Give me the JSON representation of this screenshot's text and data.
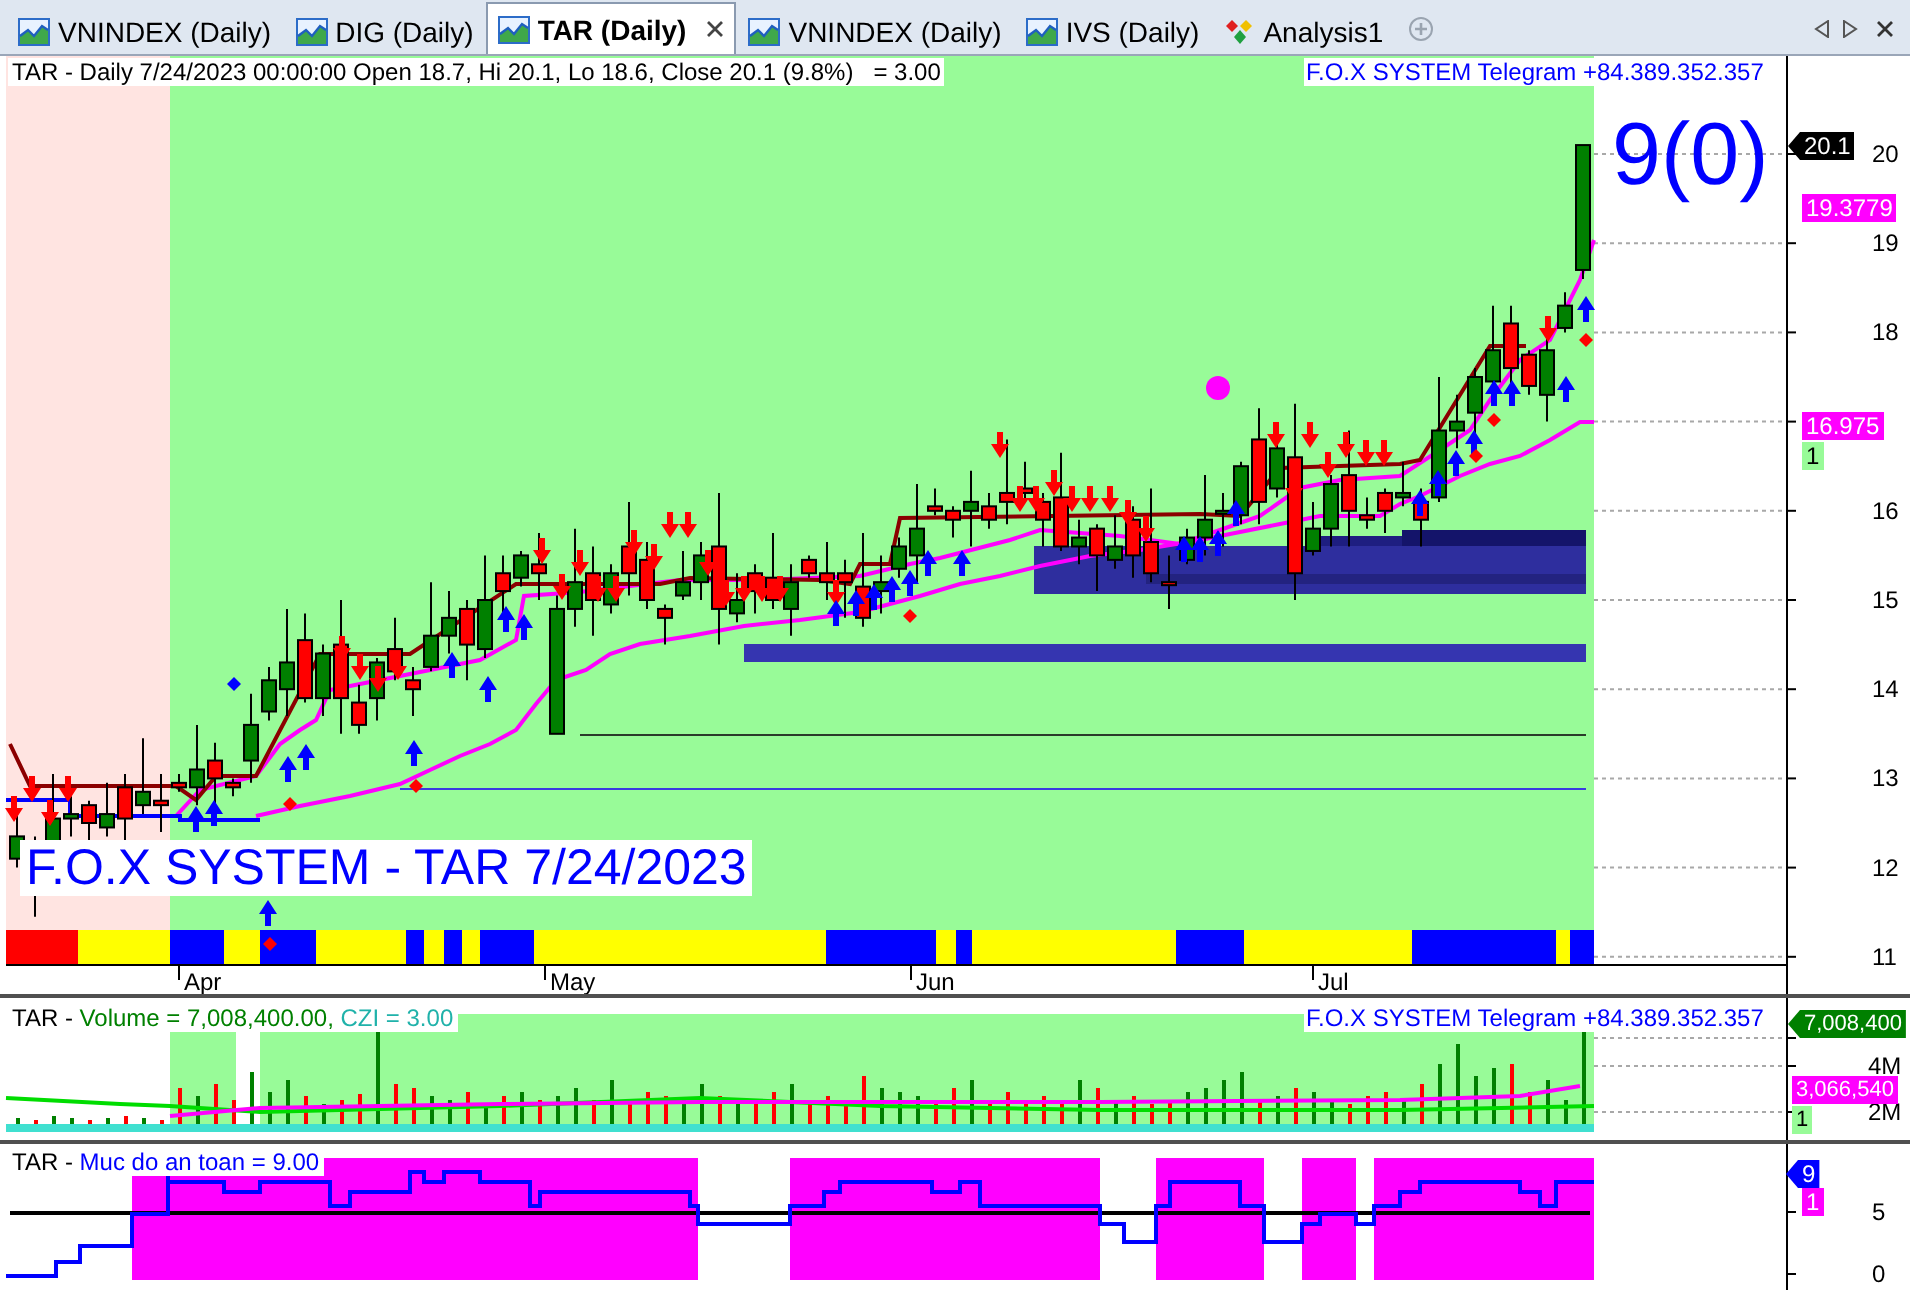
{
  "tabs": [
    {
      "label": "VNINDEX (Daily)",
      "selected": false,
      "kind": "chart"
    },
    {
      "label": "DIG (Daily)",
      "selected": false,
      "kind": "chart"
    },
    {
      "label": "TAR (Daily)",
      "selected": true,
      "kind": "chart"
    },
    {
      "label": "VNINDEX (Daily)",
      "selected": false,
      "kind": "chart"
    },
    {
      "label": "IVS (Daily)",
      "selected": false,
      "kind": "chart"
    },
    {
      "label": "Analysis1",
      "selected": false,
      "kind": "analysis"
    }
  ],
  "price_panel": {
    "header": "TAR - Daily 7/24/2023 00:00:00 Open 18.7, Hi 20.1, Lo 18.6, Close 20.1 (9.8%)   = 3.00",
    "contact": "F.O.X SYSTEM Telegram +84.389.352.357",
    "signal": "9(0)",
    "caption": "F.O.X SYSTEM - TAR 7/24/2023",
    "axis_upper": [
      "20",
      "19",
      "18"
    ],
    "axis_lower": [
      "16",
      "15",
      "14",
      "13",
      "12",
      "11"
    ],
    "badges": [
      {
        "text": "20.1",
        "color": "#000000",
        "kind": "pointer"
      },
      {
        "text": "19.3779",
        "color": "#ff00ff",
        "kind": "plain"
      },
      {
        "text": "16.975",
        "color": "#ff00ff",
        "kind": "plain"
      },
      {
        "text": "1",
        "color": "#98fb98",
        "kind": "plain"
      }
    ],
    "months": [
      "Apr",
      "May",
      "Jun",
      "Jul"
    ]
  },
  "volume_panel": {
    "header": [
      {
        "text": "TAR -",
        "color": "#000000"
      },
      {
        "text": "Volume = 7,008,400.00,",
        "color": "#008000"
      },
      {
        "text": "CZI = 3.00",
        "color": "#20b2aa"
      }
    ],
    "contact": "F.O.X SYSTEM Telegram +84.389.352.357",
    "axis_ticks": [
      "4M",
      "2M"
    ],
    "badges": [
      {
        "text": "7,008,400",
        "color": "#008000",
        "kind": "pointer"
      },
      {
        "text": "3,066,540",
        "color": "#ff00ff",
        "kind": "plain"
      },
      {
        "text": "1",
        "color": "#98fb98",
        "kind": "plain"
      }
    ]
  },
  "safety_panel": {
    "header": [
      {
        "text": "TAR -",
        "color": "#000000"
      },
      {
        "text": "Muc do an toan = 9.00",
        "color": "#0000ff"
      }
    ],
    "axis_ticks": [
      "5",
      "0"
    ],
    "badges": [
      {
        "text": "9",
        "color": "#0000ff",
        "kind": "pointer"
      },
      {
        "text": "1",
        "color": "#ff00ff",
        "kind": "plain"
      }
    ]
  }
}
